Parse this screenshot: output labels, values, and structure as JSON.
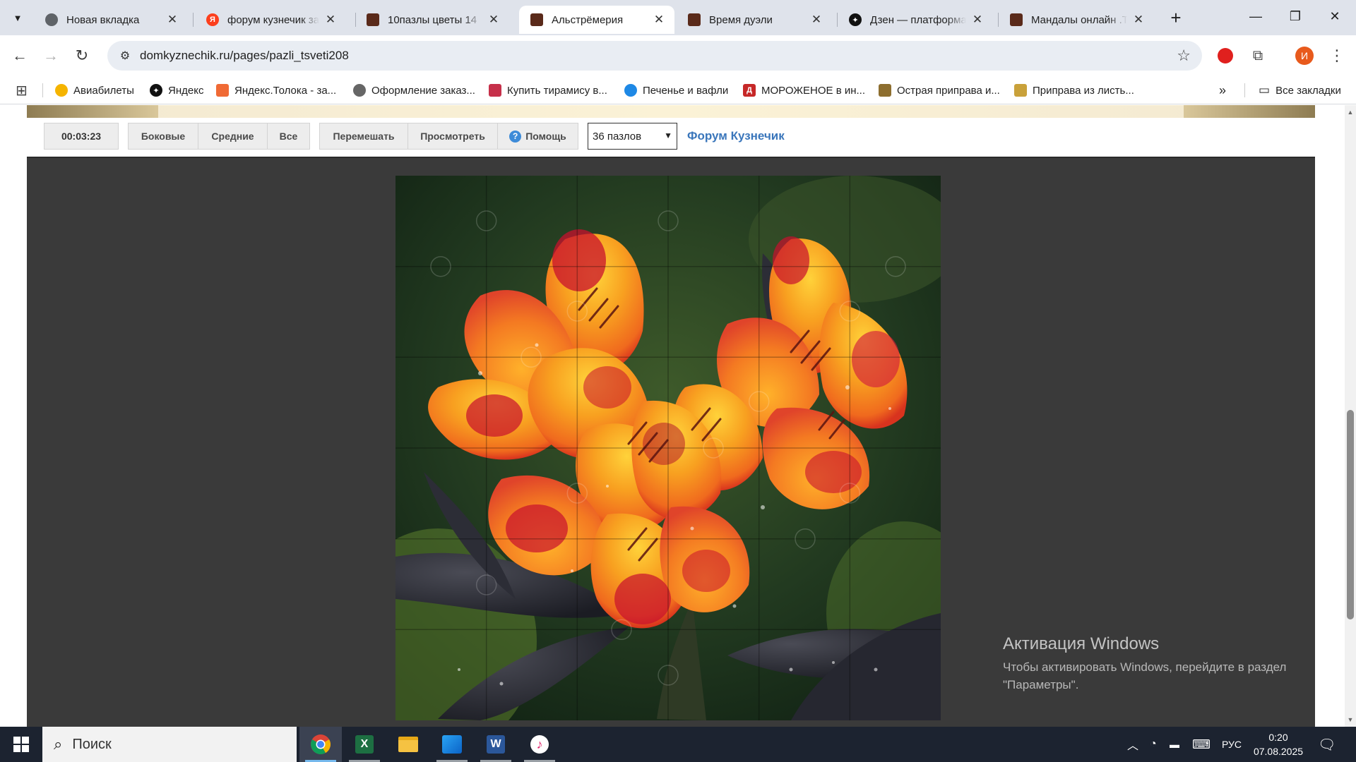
{
  "browser": {
    "tabs": [
      {
        "title": "Новая вкладка",
        "favicon": "chrome-icon",
        "active": false
      },
      {
        "title": "форум кузнечик за",
        "favicon": "yandex-icon",
        "active": false
      },
      {
        "title": "10пазлы цветы 14",
        "favicon": "site-icon",
        "active": false
      },
      {
        "title": "Альстрёмерия",
        "favicon": "site-icon",
        "active": true
      },
      {
        "title": "Время дуэли",
        "favicon": "site-icon",
        "active": false
      },
      {
        "title": "Дзен — платформа",
        "favicon": "dzen-icon",
        "active": false
      },
      {
        "title": "Мандалы онлайн .Т",
        "favicon": "site-icon",
        "active": false
      }
    ],
    "url": "domkyznechik.ru/pages/pazli_tsveti208",
    "bookmarks": [
      {
        "label": "Авиабилеты"
      },
      {
        "label": "Яндекс"
      },
      {
        "label": "Яндекс.Толока - за..."
      },
      {
        "label": "Оформление заказ..."
      },
      {
        "label": "Купить тирамису в..."
      },
      {
        "label": "Печенье и вафли"
      },
      {
        "label": "МОРОЖЕНОЕ в ин..."
      },
      {
        "label": "Острая приправа и..."
      },
      {
        "label": "Приправа из листь..."
      }
    ],
    "all_bookmarks": "Все закладки",
    "profile_initial": "И"
  },
  "puzzle": {
    "timer": "00:03:23",
    "buttons": {
      "sides": "Боковые",
      "middle": "Средние",
      "all": "Все",
      "shuffle": "Перемешать",
      "preview": "Просмотреть",
      "help": "Помощь"
    },
    "pieces_selected": "36 пазлов",
    "forum_link": "Форум Кузнечик",
    "grid": {
      "rows": 6,
      "cols": 6
    }
  },
  "activation": {
    "heading": "Активация Windows",
    "line1": "Чтобы активировать Windows, перейдите в раздел",
    "line2": "\"Параметры\"."
  },
  "taskbar": {
    "search_placeholder": "Поиск",
    "lang": "РУС",
    "time": "0:20",
    "date": "07.08.2025"
  }
}
